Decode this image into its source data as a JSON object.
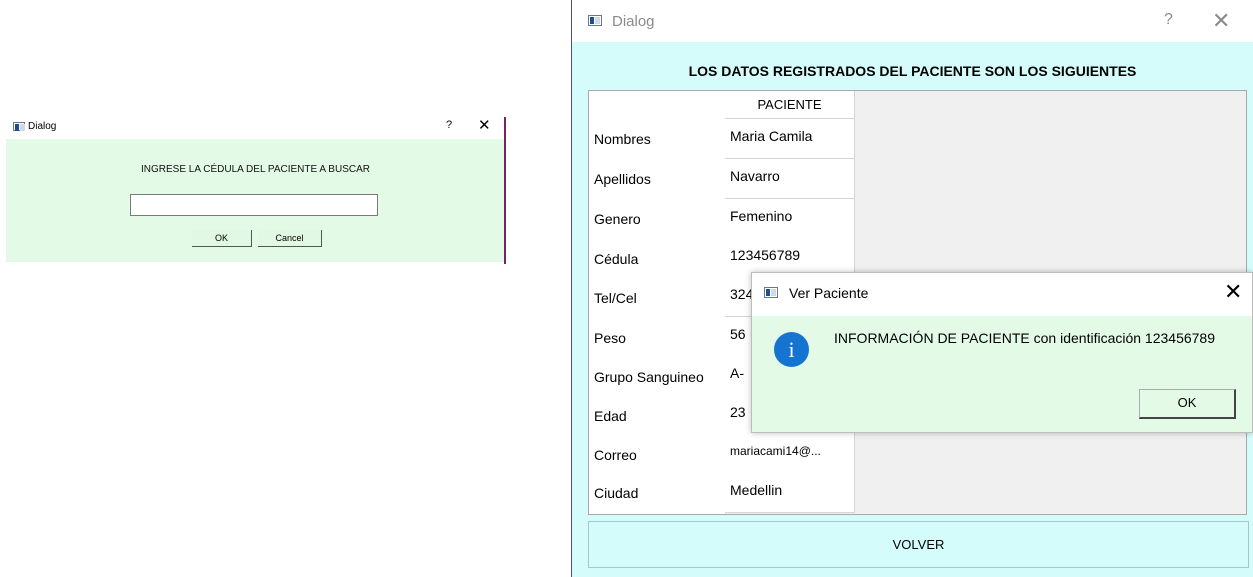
{
  "search_dialog": {
    "title": "Dialog",
    "help": "?",
    "close": "✕",
    "prompt": "INGRESE LA CÉDULA DEL PACIENTE A BUSCAR",
    "input_value": "",
    "ok_label": "OK",
    "cancel_label": "Cancel"
  },
  "patient_dialog": {
    "title": "Dialog",
    "help": "?",
    "close": "✕",
    "heading": "LOS DATOS REGISTRADOS DEL PACIENTE SON LOS SIGUIENTES",
    "column_header": "PACIENTE",
    "rows": [
      {
        "label": "Nombres",
        "value": "Maria Camila"
      },
      {
        "label": "Apellidos",
        "value": "Navarro"
      },
      {
        "label": "Genero",
        "value": "Femenino"
      },
      {
        "label": "Cédula",
        "value": "123456789"
      },
      {
        "label": "Tel/Cel",
        "value": "324"
      },
      {
        "label": "Peso",
        "value": "56"
      },
      {
        "label": "Grupo Sanguineo",
        "value": "A-"
      },
      {
        "label": "Edad",
        "value": "23"
      },
      {
        "label": "Correo",
        "value": "mariacami14@..."
      },
      {
        "label": "Ciudad",
        "value": "Medellin"
      }
    ],
    "back_label": "VOLVER"
  },
  "message_box": {
    "title": "Ver Paciente",
    "close": "✕",
    "icon": "info-icon",
    "icon_glyph": "i",
    "text": "INFORMACIÓN DE PACIENTE con identificación 123456789",
    "ok_label": "OK"
  },
  "colors": {
    "search_body": "#e3fae6",
    "patient_body": "#d5fcfb",
    "info_icon": "#1674d1"
  }
}
